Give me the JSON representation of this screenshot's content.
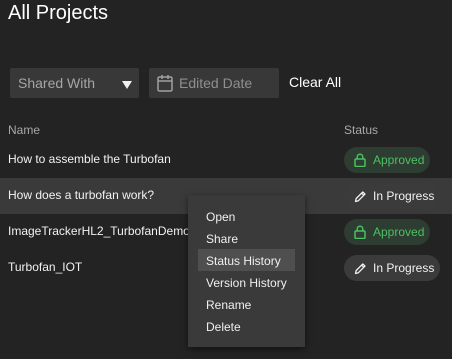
{
  "page": {
    "title": "All Projects"
  },
  "filters": {
    "shared_with_label": "Shared With",
    "edited_date_label": "Edited Date",
    "clear_all_label": "Clear All"
  },
  "table": {
    "columns": {
      "name": "Name",
      "status": "Status"
    },
    "rows": [
      {
        "name": "How to assemble the Turbofan",
        "status": "Approved",
        "status_type": "approved"
      },
      {
        "name": "How does a turbofan work?",
        "status": "In Progress",
        "status_type": "in-progress"
      },
      {
        "name": "ImageTrackerHL2_TurbofanDemo",
        "status": "Approved",
        "status_type": "approved"
      },
      {
        "name": "Turbofan_IOT",
        "status": "In Progress",
        "status_type": "in-progress"
      }
    ]
  },
  "context_menu": {
    "items": [
      "Open",
      "Share",
      "Status History",
      "Version History",
      "Rename",
      "Delete"
    ],
    "highlighted": "Status History"
  },
  "colors": {
    "background": "#232323",
    "approved": "#4cc061",
    "approved_bg": "#2d3d32",
    "progress_bg": "#3b3b3b"
  },
  "icons": {
    "dropdown": "triangle-down-icon",
    "date": "calendar-icon",
    "approved": "lock-icon",
    "in_progress": "pencil-icon"
  }
}
